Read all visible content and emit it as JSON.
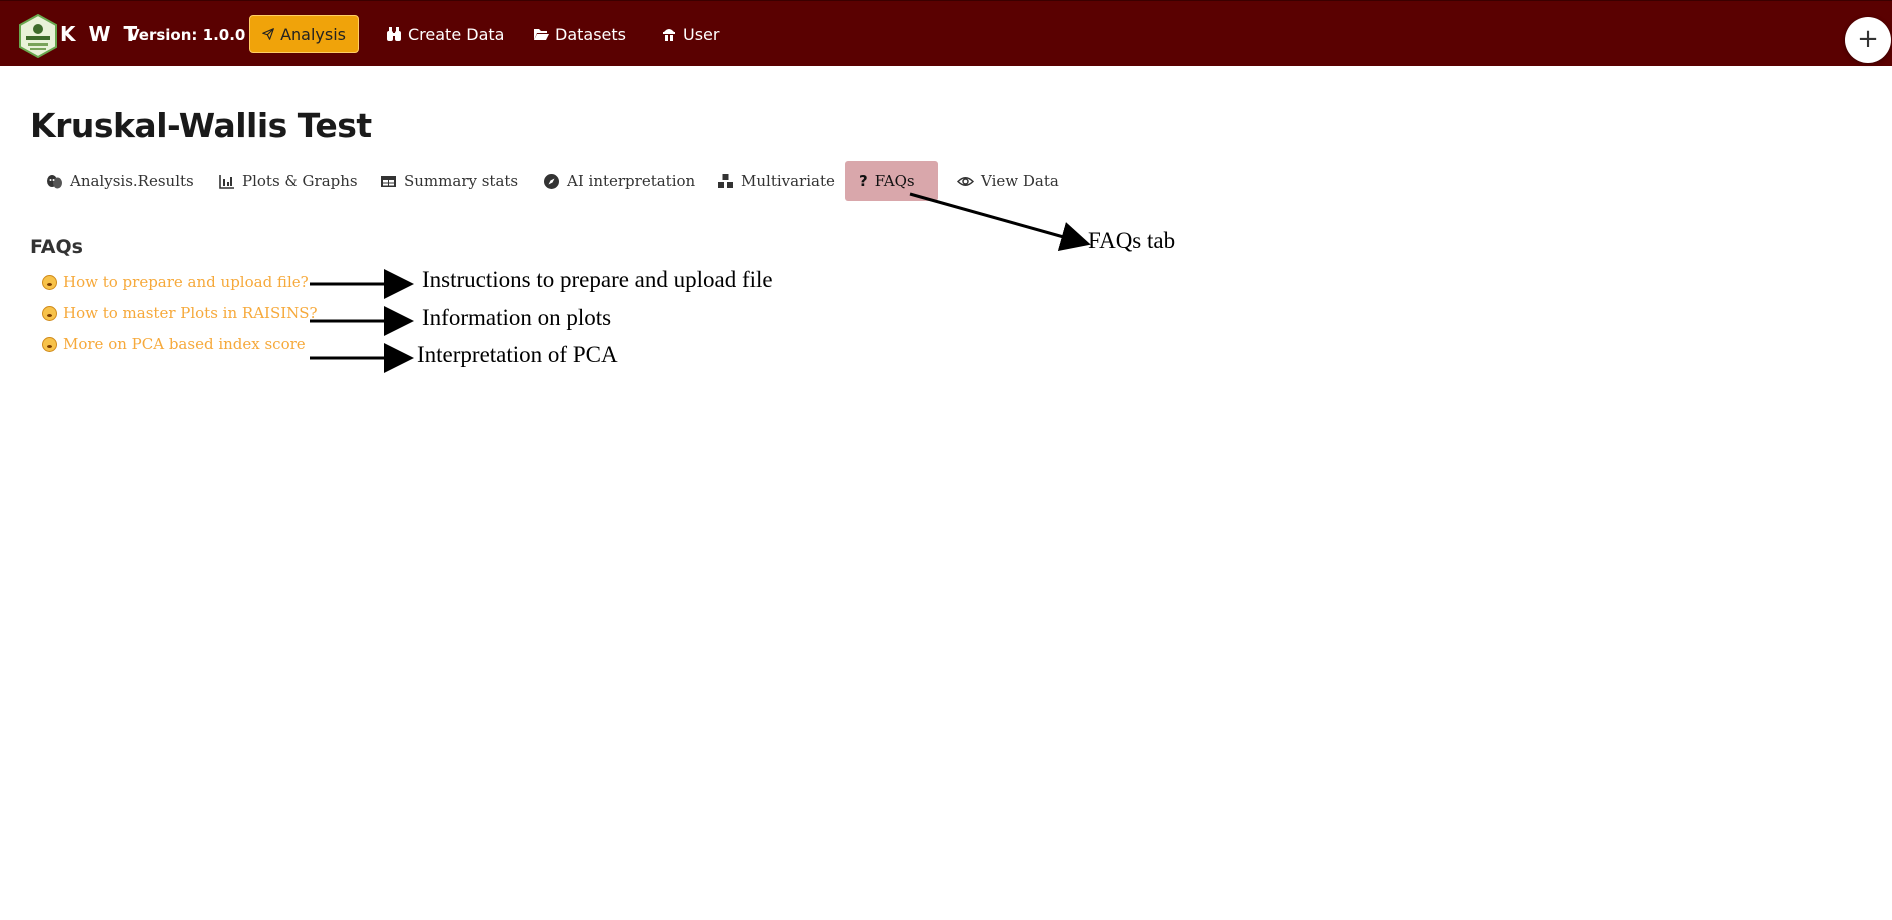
{
  "navbar": {
    "brand": "K W T",
    "version": "Version: 1.0.0",
    "items": [
      {
        "label": "Analysis",
        "icon": "paper-plane-icon",
        "active": true
      },
      {
        "label": "Create Data",
        "icon": "binoculars-icon",
        "active": false
      },
      {
        "label": "Datasets",
        "icon": "folder-open-icon",
        "active": false
      },
      {
        "label": "User",
        "icon": "user-icon",
        "active": false
      }
    ],
    "plus_label": "+"
  },
  "page": {
    "title": "Kruskal-Wallis Test"
  },
  "tabs": [
    {
      "label": "Analysis.Results",
      "icon": "theater-masks-icon",
      "active": false
    },
    {
      "label": "Plots & Graphs",
      "icon": "chart-icon",
      "active": false
    },
    {
      "label": "Summary stats",
      "icon": "table-icon",
      "active": false
    },
    {
      "label": "AI interpretation",
      "icon": "compass-icon",
      "active": false
    },
    {
      "label": "Multivariate",
      "icon": "cubes-icon",
      "active": false
    },
    {
      "label": "FAQs",
      "icon": "question-icon",
      "active": true
    },
    {
      "label": "View Data",
      "icon": "eye-icon",
      "active": false
    }
  ],
  "faqs": {
    "heading": "FAQs",
    "items": [
      {
        "label": "How to prepare and upload file?",
        "icon": "emoji-icon"
      },
      {
        "label": "How to master Plots in RAISINS?",
        "icon": "emoji-icon"
      },
      {
        "label": "More on PCA based index score",
        "icon": "emoji-icon"
      }
    ]
  },
  "annotations": {
    "faqs_tab": "FAQs tab",
    "upload": "Instructions to prepare and upload file",
    "plots": "Information on plots",
    "pca": "Interpretation of PCA"
  },
  "colors": {
    "navbar": "#5a0101",
    "active_nav": "#f0a30a",
    "active_tab": "#d9a7ab",
    "faq_link": "#f6a93b"
  }
}
